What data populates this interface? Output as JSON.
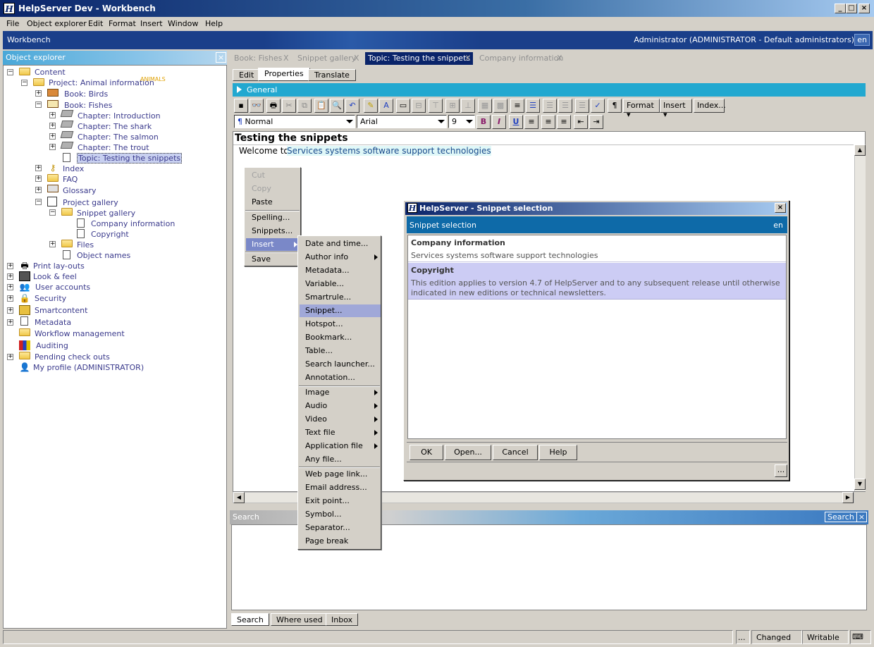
{
  "window": {
    "title": "HelpServer Dev - Workbench",
    "app_icon": "H",
    "min": "_",
    "max": "□",
    "close": "×"
  },
  "menubar": [
    "File",
    "Object explorer",
    "Edit",
    "Format",
    "Insert",
    "Window",
    "Help"
  ],
  "workbench": {
    "label": "Workbench",
    "user": "Administrator (ADMINISTRATOR - Default administrators)",
    "lang": "en"
  },
  "explorer": {
    "title": "Object explorer",
    "close": "×",
    "tree": [
      "Content",
      "Project: Animal information",
      "ANIMALS",
      "Book: Birds",
      "Book: Fishes",
      "Chapter: Introduction",
      "Chapter: The shark",
      "Chapter: The salmon",
      "Chapter: The trout",
      "Topic: Testing the snippets",
      "Index",
      "FAQ",
      "Glossary",
      "Project gallery",
      "Snippet gallery",
      "Company information",
      "Copyright",
      "Files",
      "Object names",
      "Print lay-outs",
      "Look & feel",
      "User accounts",
      "Security",
      "Smartcontent",
      "Metadata",
      "Workflow management",
      "Auditing",
      "Pending check outs",
      "My profile (ADMINISTRATOR)"
    ]
  },
  "doc_tabs": [
    "Book: Fishes",
    "Snippet gallery",
    "Topic: Testing the snippets",
    "Company information"
  ],
  "tab_close": "X",
  "sub_tabs": [
    "Edit",
    "Properties",
    "Translate"
  ],
  "general": "General",
  "toolbar": {
    "format": "Format",
    "insert": "Insert",
    "index": "Index...",
    "style": "Normal",
    "font": "Arial",
    "size": "9",
    "pilcrow": "¶",
    "bold": "B",
    "italic": "I",
    "underline": "U"
  },
  "editor": {
    "heading": "Testing the snippets",
    "welcome": "Welcome to",
    "snippet": "Services systems software support technologies"
  },
  "context_menu": [
    "Cut",
    "Copy",
    "Paste",
    "Spelling...",
    "Snippets...",
    "Insert",
    "Save"
  ],
  "insert_menu": [
    "Date and time...",
    "Author info",
    "Metadata...",
    "Variable...",
    "Smartrule...",
    "Snippet...",
    "Hotspot...",
    "Bookmark...",
    "Table...",
    "Search launcher...",
    "Annotation...",
    "Image",
    "Audio",
    "Video",
    "Text file",
    "Application file",
    "Any file...",
    "Web page link...",
    "Email address...",
    "Exit point...",
    "Symbol...",
    "Separator...",
    "Page break"
  ],
  "dialog": {
    "title": "HelpServer - Snippet selection",
    "subtitle": "Snippet selection",
    "lang": "en",
    "close": "×",
    "items": [
      {
        "title": "Company information",
        "text": "Services systems software support technologies"
      },
      {
        "title": "Copyright",
        "text": "This edition applies to version 4.7 of HelpServer and to any subsequent release until otherwise indicated in new editions or technical newsletters."
      }
    ],
    "buttons": [
      "OK",
      "Open...",
      "Cancel",
      "Help"
    ],
    "more": "..."
  },
  "search": {
    "title": "Search",
    "button": "Search",
    "close": "×"
  },
  "bottom_tabs": [
    "Search",
    "Where used",
    "Inbox"
  ],
  "status": {
    "dots": "...",
    "changed": "Changed",
    "writable": "Writable"
  }
}
